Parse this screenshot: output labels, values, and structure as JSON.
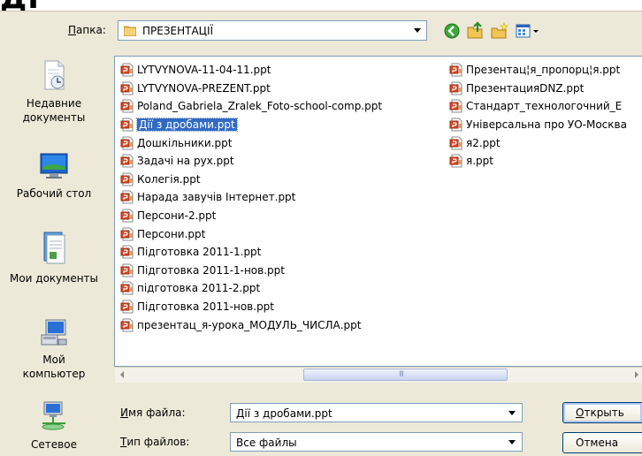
{
  "window": {
    "bg_title_fragment": "ДІ"
  },
  "toolbar": {
    "folder_label": "Папка:",
    "folder_label_key": "П",
    "folder_label_rest": "апка:",
    "current_folder": "ПРЕЗЕНТАЦІЇ"
  },
  "places": [
    {
      "label_line1": "Недавние",
      "label_line2": "документы",
      "icon": "recent-documents-icon"
    },
    {
      "label_line1": "Рабочий стол",
      "label_line2": "",
      "icon": "desktop-icon"
    },
    {
      "label_line1": "Мои документы",
      "label_line2": "",
      "icon": "my-documents-icon"
    },
    {
      "label_line1": "Мой",
      "label_line2": "компьютер",
      "icon": "my-computer-icon"
    },
    {
      "label_line1": "Сетевое",
      "label_line2": "",
      "icon": "network-icon"
    }
  ],
  "files_col1": [
    "LYTVYNOVA-11-04-11.ppt",
    "LYTVYNOVA-PREZENT.ppt",
    "Poland_Gabriela_Zralek_Foto-school-comp.ppt",
    "Дії з дробами.ppt",
    "Дошкільники.ppt",
    "Задачі на рух.ppt",
    "Колегія.ppt",
    "Нарада завучів Інтернет.ppt",
    "Персони-2.ppt",
    "Персони.ppt",
    "Підготовка 2011-1.ppt",
    "Підготовка 2011-1-нов.ppt",
    "підготовка 2011-2.ppt",
    "Підготовка 2011-нов.ppt",
    "презентац_я-урока_МОДУЛЬ_ЧИСЛА.ppt"
  ],
  "files_col2": [
    "Презентац¦я_пропорц¦я.ppt",
    "ПрезентацияDNZ.ppt",
    "Стандарт_технологочний_Е",
    "Універсальна про УО-Москва",
    "я2.ppt",
    "я.ppt"
  ],
  "selected_file": "Дії з дробами.ppt",
  "filename": {
    "label_key": "И",
    "label_rest": "мя файла:",
    "value": "Дії з дробами.ppt"
  },
  "filetype": {
    "label_key": "Т",
    "label_rest": "ип файлов:",
    "value": "Все файлы"
  },
  "buttons": {
    "open_key": "О",
    "open_rest": "ткрыть",
    "cancel": "Отмена"
  },
  "scrollbar": {
    "grip": "III"
  }
}
